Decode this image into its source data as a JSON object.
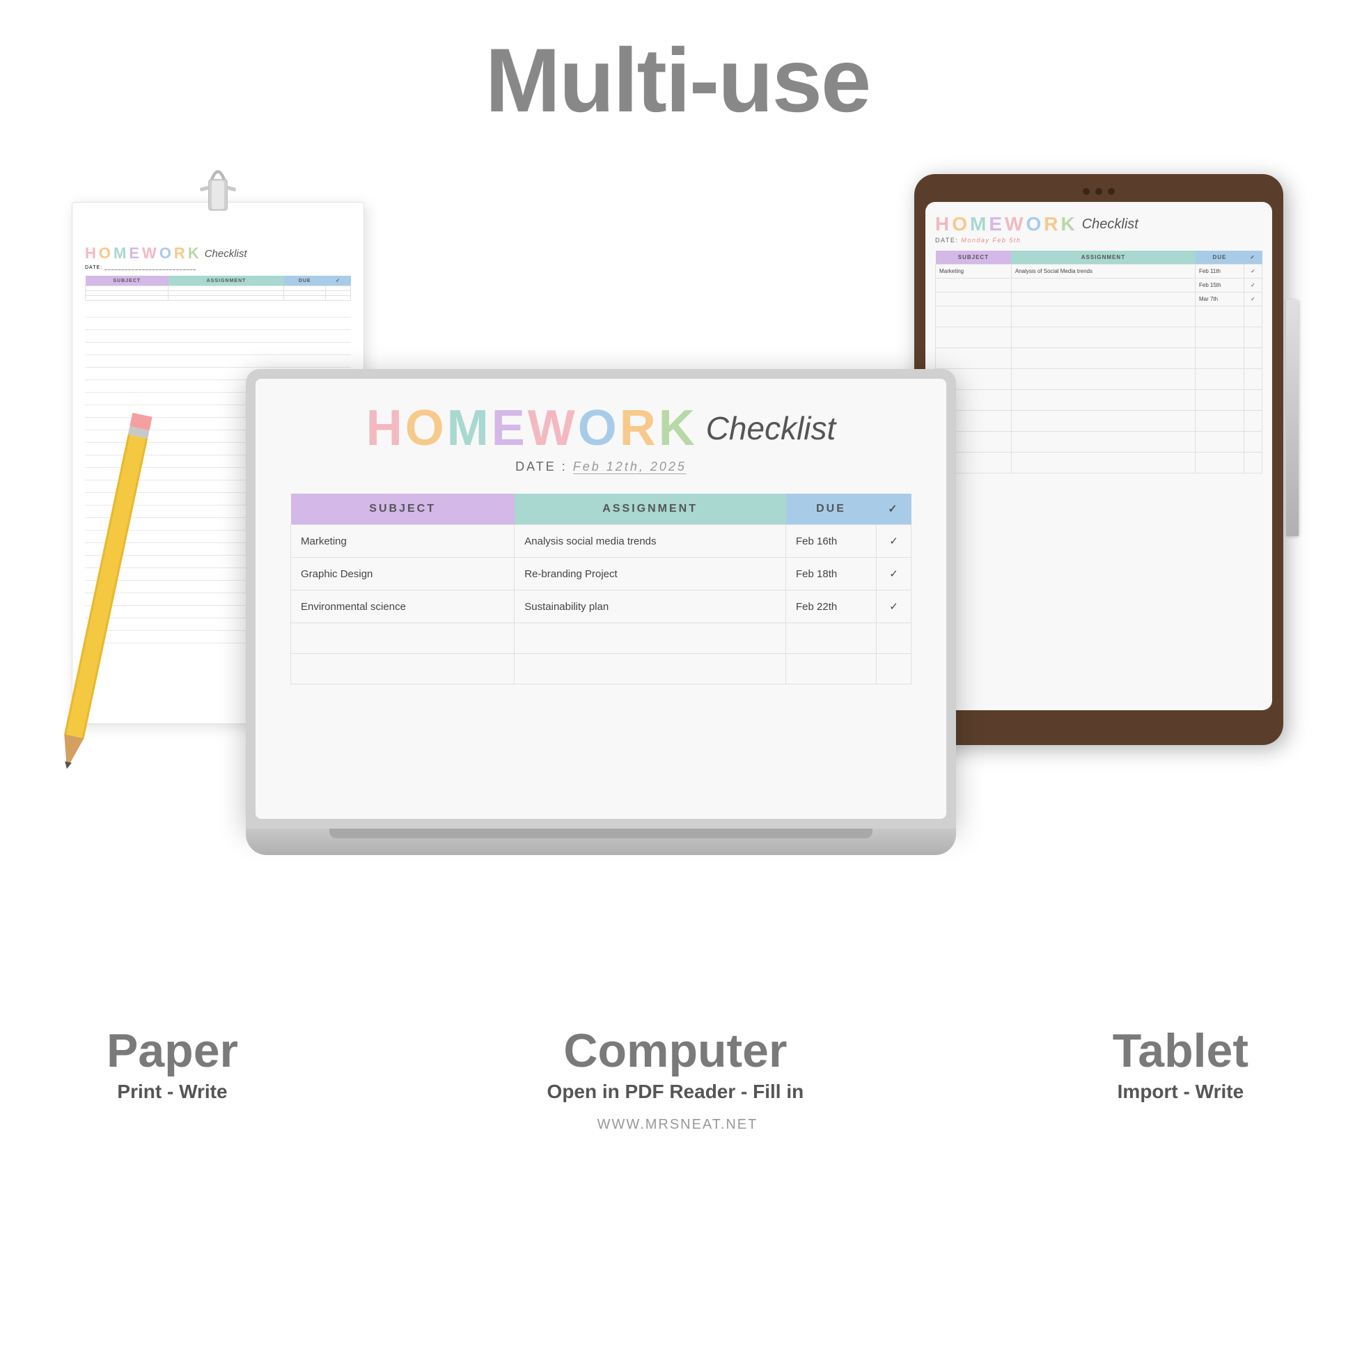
{
  "title": "Multi-use",
  "paper": {
    "date_label": "DATE:",
    "hw_letters": [
      {
        "letter": "H",
        "color": "#f4b8c1"
      },
      {
        "letter": "O",
        "color": "#f7c98b"
      },
      {
        "letter": "M",
        "color": "#a8d8d0"
      },
      {
        "letter": "E",
        "color": "#d4b8e8"
      },
      {
        "letter": "W",
        "color": "#f4b8c1"
      },
      {
        "letter": "O",
        "color": "#a8cce8"
      },
      {
        "letter": "R",
        "color": "#f7c98b"
      },
      {
        "letter": "K",
        "color": "#b8d8a8"
      }
    ],
    "checklist": "Checklist",
    "table_headers": [
      "SUBJECT",
      "ASSIGNMENT",
      "DUE",
      "✓"
    ],
    "rows": []
  },
  "laptop": {
    "date_label": "DATE :",
    "date_value": "Feb 12th, 2025",
    "hw_letters": [
      {
        "letter": "H",
        "color": "#f4b8c1"
      },
      {
        "letter": "O",
        "color": "#f7c98b"
      },
      {
        "letter": "M",
        "color": "#a8d8d0"
      },
      {
        "letter": "E",
        "color": "#d4b8e8"
      },
      {
        "letter": "W",
        "color": "#f4b8c1"
      },
      {
        "letter": "O",
        "color": "#a8cce8"
      },
      {
        "letter": "R",
        "color": "#f7c98b"
      },
      {
        "letter": "K",
        "color": "#b8d8a8"
      }
    ],
    "checklist": "Checklist",
    "table_headers": [
      "SUBJECT",
      "ASSIGNMENT",
      "DUE",
      "✓"
    ],
    "rows": [
      {
        "subject": "Marketing",
        "assignment": "Analysis social media trends",
        "due": "Feb 16th",
        "check": "✓"
      },
      {
        "subject": "Graphic Design",
        "assignment": "Re-branding Project",
        "due": "Feb 18th",
        "check": "✓"
      },
      {
        "subject": "Environmental science",
        "assignment": "Sustainability plan",
        "due": "Feb 22th",
        "check": "✓"
      },
      {
        "subject": "",
        "assignment": "",
        "due": "",
        "check": ""
      },
      {
        "subject": "",
        "assignment": "",
        "due": "",
        "check": ""
      }
    ]
  },
  "tablet": {
    "date_label": "DATE:",
    "date_value": "Monday Feb 5th",
    "hw_letters": [
      {
        "letter": "H",
        "color": "#f4b8c1"
      },
      {
        "letter": "O",
        "color": "#f7c98b"
      },
      {
        "letter": "M",
        "color": "#a8d8d0"
      },
      {
        "letter": "E",
        "color": "#d4b8e8"
      },
      {
        "letter": "W",
        "color": "#f4b8c1"
      },
      {
        "letter": "O",
        "color": "#a8cce8"
      },
      {
        "letter": "R",
        "color": "#f7c98b"
      },
      {
        "letter": "K",
        "color": "#b8d8a8"
      }
    ],
    "checklist": "Checklist",
    "table_headers": [
      "SUBJECT",
      "ASSIGNMENT",
      "DUE",
      "✓"
    ],
    "rows": [
      {
        "subject": "Marketing",
        "assignment": "Analysis of Social Media trends",
        "due": "Feb 11th",
        "check": "✓"
      },
      {
        "subject": "",
        "assignment": "",
        "due": "Feb 15th",
        "check": "✓"
      },
      {
        "subject": "",
        "assignment": "",
        "due": "Mar 7th",
        "check": "✓"
      },
      {
        "subject": "",
        "assignment": "",
        "due": "",
        "check": ""
      },
      {
        "subject": "",
        "assignment": "",
        "due": "",
        "check": ""
      },
      {
        "subject": "",
        "assignment": "",
        "due": "",
        "check": ""
      },
      {
        "subject": "",
        "assignment": "",
        "due": "",
        "check": ""
      }
    ]
  },
  "labels": [
    {
      "main": "Paper",
      "sub": "Print - Write"
    },
    {
      "main": "Computer",
      "sub": "Open in PDF Reader - Fill in"
    },
    {
      "main": "Tablet",
      "sub": "Import - Write"
    }
  ],
  "footer": "WWW.MRSNEAT.NET"
}
